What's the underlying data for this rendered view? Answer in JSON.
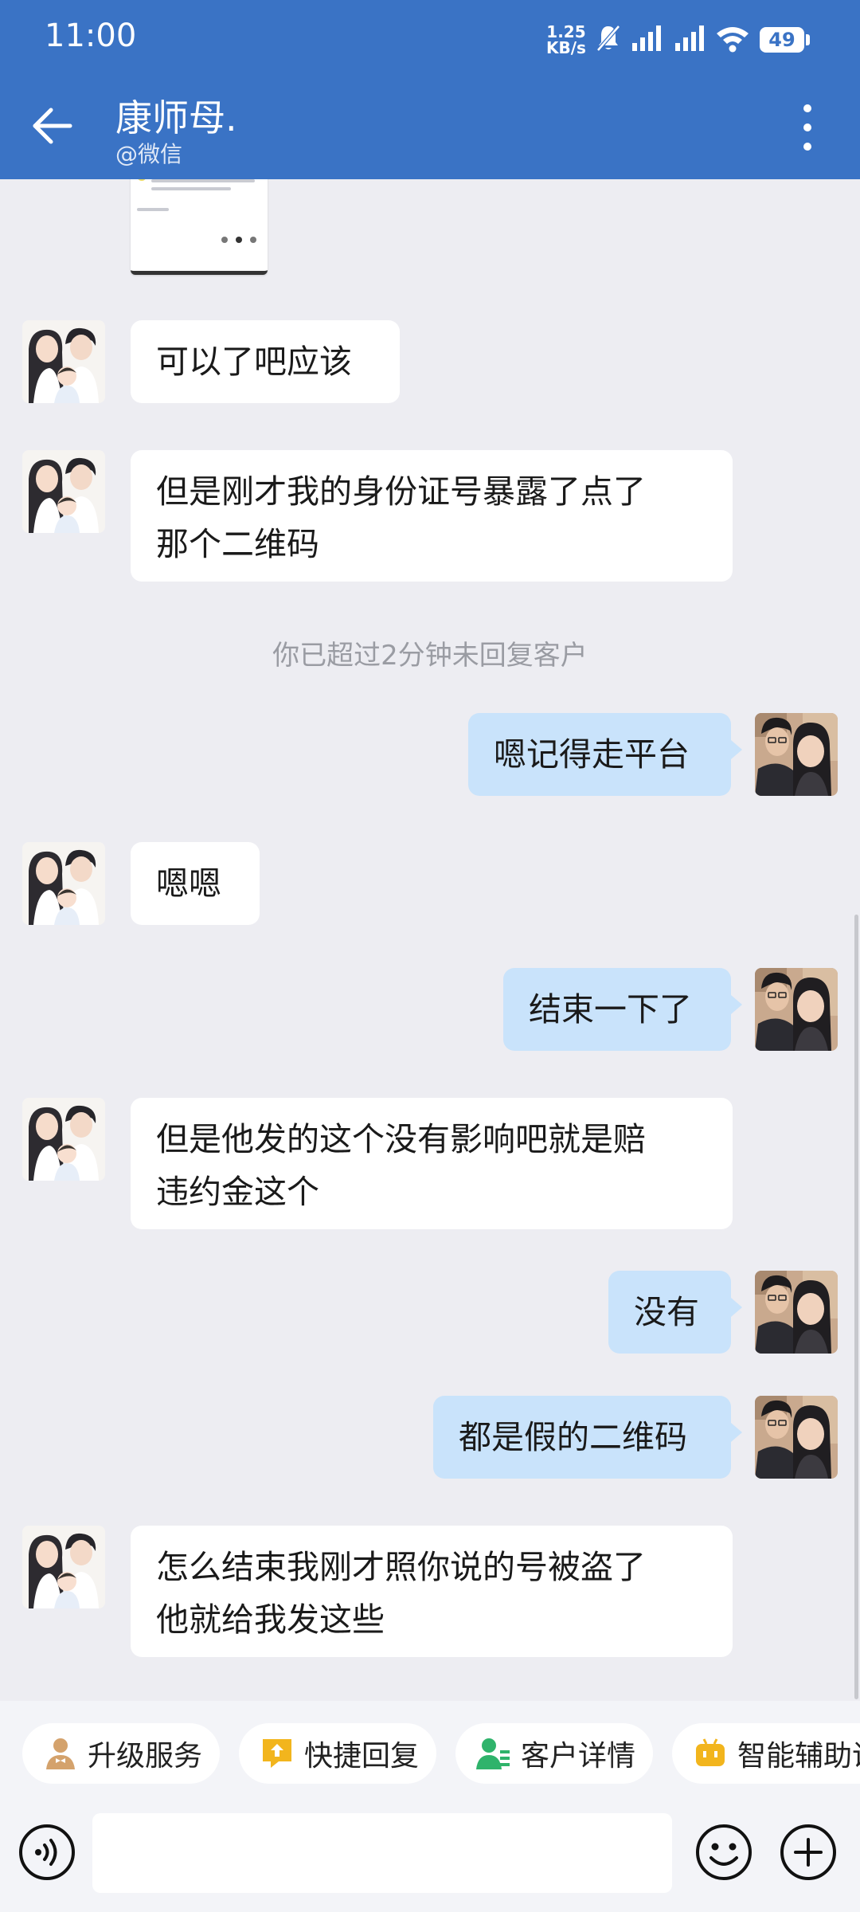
{
  "status_bar": {
    "time": "11:00",
    "net_speed_value": "1.25",
    "net_speed_unit": "KB/s",
    "battery": "49"
  },
  "header": {
    "title": "康师母.",
    "subtitle": "@微信"
  },
  "messages": [
    {
      "text": "可以了吧应该"
    },
    {
      "line1": "但是刚才我的身份证号暴露了点了",
      "line2": "那个二维码"
    },
    {
      "text": "嗯记得走平台"
    },
    {
      "text": "嗯嗯"
    },
    {
      "text": "结束一下了"
    },
    {
      "line1": "但是他发的这个没有影响吧就是赔",
      "line2": "违约金这个"
    },
    {
      "text": "没有"
    },
    {
      "text": "都是假的二维码"
    },
    {
      "line1": "怎么结束我刚才照你说的号被盗了",
      "line2": "他就给我发这些"
    }
  ],
  "system_note": "你已超过2分钟未回复客户",
  "quick_actions": [
    {
      "label": "升级服务",
      "icon": "person-bowtie-icon"
    },
    {
      "label": "快捷回复",
      "icon": "reply-icon"
    },
    {
      "label": "客户详情",
      "icon": "customer-detail-icon"
    },
    {
      "label": "智能辅助说",
      "icon": "robot-icon"
    }
  ],
  "input": {
    "placeholder": ""
  },
  "colors": {
    "header_bg": "#3a73c5",
    "chat_bg": "#ededf2",
    "incoming_bubble": "#ffffff",
    "outgoing_bubble": "#c9e3fb"
  }
}
